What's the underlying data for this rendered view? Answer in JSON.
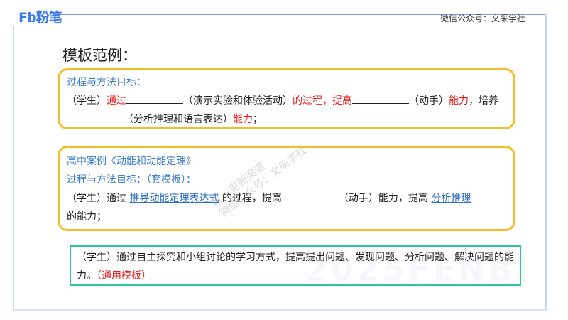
{
  "header": {
    "logo": "Fb粉笔",
    "wechat": "微信公众号：文采学社"
  },
  "title": "模板范例：",
  "box1": {
    "heading": "过程与方法目标：",
    "t1": "（学生）",
    "t2": "通过",
    "t3": "（演示实验和体验活动）",
    "t4": "的过程，提高",
    "t5": "（动手）",
    "t6": "能力",
    "t7": "，培养",
    "t8": "（分析推理和语言表达）",
    "t9": "能力",
    "t10": "；"
  },
  "box2": {
    "heading": "高中案例《动能和动能定理》",
    "subheading": "过程与方法目标：（套模板）：",
    "t1": "（学生）通过 ",
    "link1": "推导动能定理表达式",
    "t2": " 的过程，提高",
    "t3": "（动手）",
    "t4": "能力，提高 ",
    "link2": "分析推理",
    "t5": "的能力；"
  },
  "box3": {
    "text": "（学生）通过自主探究和小组讨论的学习方式，提高提出问题、发现问题、分析问题、解决问题的能力。",
    "tag": "（通用模板）"
  },
  "watermark": {
    "line1": "唯一更新渠道",
    "line2": "微信公众号：文采学社",
    "bg": "2025FENBI"
  }
}
